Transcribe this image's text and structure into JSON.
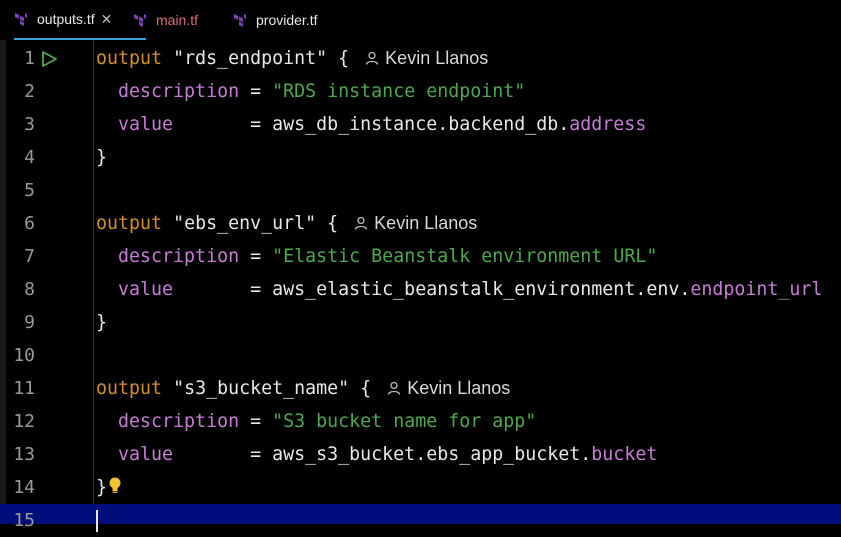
{
  "tabs": [
    {
      "label": "outputs.tf",
      "active": true,
      "closable": true,
      "color": "#e8e8e8"
    },
    {
      "label": "main.tf",
      "active": false,
      "color": "#e06c75"
    },
    {
      "label": "provider.tf",
      "active": false,
      "color": "#e8e8e8"
    }
  ],
  "colors": {
    "keyword": "#d08f2f",
    "string": "#4fa84f",
    "property": "#c77dd6",
    "current_line": "#000d7a",
    "terraform_icon": "#7b42bc"
  },
  "author": "Kevin Llanos",
  "lines": [
    {
      "n": "1"
    },
    {
      "n": "2"
    },
    {
      "n": "3"
    },
    {
      "n": "4"
    },
    {
      "n": "5"
    },
    {
      "n": "6"
    },
    {
      "n": "7"
    },
    {
      "n": "8"
    },
    {
      "n": "9"
    },
    {
      "n": "10"
    },
    {
      "n": "11"
    },
    {
      "n": "12"
    },
    {
      "n": "13"
    },
    {
      "n": "14"
    },
    {
      "n": "15"
    }
  ],
  "code": {
    "kw_output": "output",
    "kw_description": "description",
    "kw_value": "value",
    "eq": " = ",
    "value_pad": "       = ",
    "brace_open": " {",
    "brace_close": "}",
    "b1": {
      "name": "\"rds_endpoint\"",
      "description": "\"RDS instance endpoint\"",
      "value_ref": "aws_db_instance.backend_db.",
      "value_attr": "address"
    },
    "b2": {
      "name": "\"ebs_env_url\"",
      "description": "\"Elastic Beanstalk environment URL\"",
      "value_ref": "aws_elastic_beanstalk_environment.env.",
      "value_attr": "endpoint_url"
    },
    "b3": {
      "name": "\"s3_bucket_name\"",
      "description": "\"S3 bucket name for app\"",
      "value_ref": "aws_s3_bucket.ebs_app_bucket.",
      "value_attr": "bucket"
    }
  }
}
